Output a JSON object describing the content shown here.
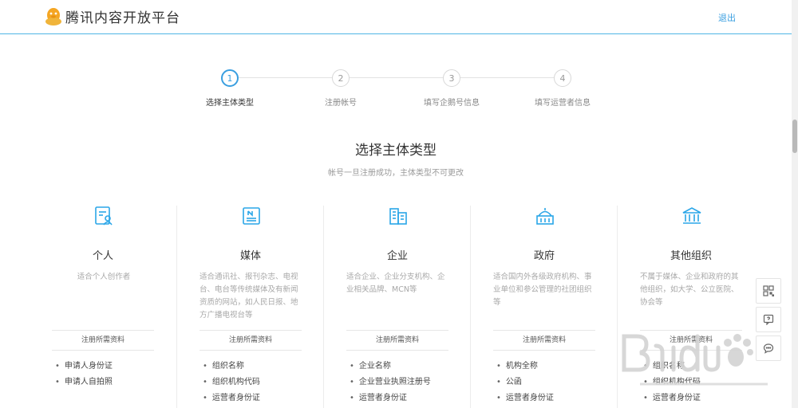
{
  "header": {
    "logo_text": "腾讯内容开放平台",
    "logout_label": "退出"
  },
  "steps": [
    {
      "number": "1",
      "label": "选择主体类型",
      "active": true
    },
    {
      "number": "2",
      "label": "注册帐号",
      "active": false
    },
    {
      "number": "3",
      "label": "填写企鹅号信息",
      "active": false
    },
    {
      "number": "4",
      "label": "填写运营者信息",
      "active": false
    }
  ],
  "main": {
    "title": "选择主体类型",
    "subtitle": "帐号一旦注册成功，主体类型不可更改"
  },
  "cards": [
    {
      "icon": "user-card-icon",
      "title": "个人",
      "description": "适合个人创作者",
      "requirements_label": "注册所需资料",
      "requirements": [
        "申请人身份证",
        "申请人自拍照"
      ]
    },
    {
      "icon": "newspaper-icon",
      "title": "媒体",
      "description": "适合通讯社、报刊杂志、电视台、电台等传统媒体及有新闻资质的网站，如人民日报、地方广播电视台等",
      "requirements_label": "注册所需资料",
      "requirements": [
        "组织名称",
        "组织机构代码",
        "运营者身份证"
      ]
    },
    {
      "icon": "office-building-icon",
      "title": "企业",
      "description": "适合企业、企业分支机构、企业相关品牌、MCN等",
      "requirements_label": "注册所需资料",
      "requirements": [
        "企业名称",
        "企业营业执照注册号",
        "运营者身份证"
      ]
    },
    {
      "icon": "government-building-icon",
      "title": "政府",
      "description": "适合国内外各级政府机构、事业单位和参公管理的社团组织等",
      "requirements_label": "注册所需资料",
      "requirements": [
        "机构全称",
        "公函",
        "运营者身份证"
      ]
    },
    {
      "icon": "institution-columns-icon",
      "title": "其他组织",
      "description": "不属于媒体、企业和政府的其他组织，如大学、公立医院、协会等",
      "requirements_label": "注册所需资料",
      "requirements": [
        "组织名称",
        "组织机构代码",
        "运营者身份证"
      ]
    }
  ],
  "side_tools": [
    "qr-code-icon",
    "help-icon",
    "feedback-chat-icon"
  ],
  "colors": {
    "accent": "#3a9fe0",
    "header_border": "#4fb5e6",
    "logo_yellow": "#f5a623"
  }
}
